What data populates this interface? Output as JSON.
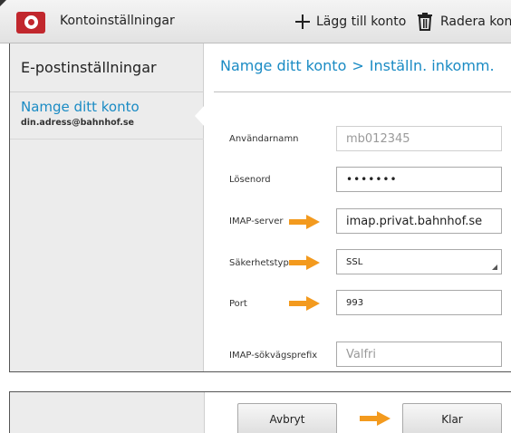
{
  "app": {
    "title": "Kontoinställningar",
    "icon": "mail-app-icon"
  },
  "actions": {
    "add_account": "Lägg till konto",
    "delete_account": "Radera konto"
  },
  "sidebar": {
    "header": "E-postinställningar",
    "account_name": "Namge ditt konto",
    "account_email": "din.adress@bahnhof.se"
  },
  "breadcrumb": {
    "step1": "Namge ditt konto",
    "separator": ">",
    "step2": "Inställn. inkomm."
  },
  "form": {
    "username": {
      "label": "Användarnamn",
      "value": "mb012345"
    },
    "password": {
      "label": "Lösenord",
      "value": "•••••••"
    },
    "imap_server": {
      "label": "IMAP-server",
      "value": "imap.privat.bahnhof.se"
    },
    "security": {
      "label": "Säkerhetstyp",
      "value": "SSL"
    },
    "port": {
      "label": "Port",
      "value": "993"
    },
    "imap_prefix": {
      "label": "IMAP-sökvägsprefix",
      "placeholder": "Valfri"
    }
  },
  "buttons": {
    "cancel": "Avbryt",
    "done": "Klar"
  },
  "colors": {
    "accent": "#1a8bc4",
    "arrow": "#f39a1e",
    "app_icon": "#c1272d"
  }
}
